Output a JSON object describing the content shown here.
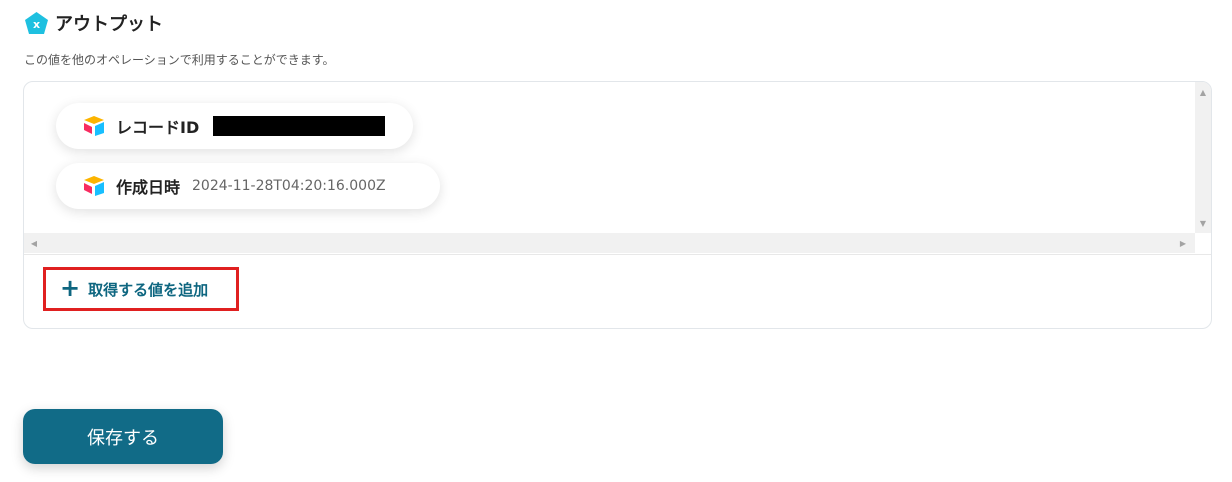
{
  "section": {
    "title": "アウトプット",
    "description": "この値を他のオペレーションで利用することができます。",
    "icon": "output-pentagon-icon"
  },
  "outputs": [
    {
      "label": "レコードID",
      "value": "",
      "redacted": true,
      "icon": "airtable-icon"
    },
    {
      "label": "作成日時",
      "value": "2024-11-28T04:20:16.000Z",
      "redacted": false,
      "icon": "airtable-icon"
    }
  ],
  "add_button": {
    "label": "取得する値を追加",
    "icon": "plus-icon"
  },
  "save_button": {
    "label": "保存する"
  },
  "colors": {
    "accent": "#116b87",
    "highlight_border": "#e02020",
    "icon_teal": "#1ec0e0"
  }
}
